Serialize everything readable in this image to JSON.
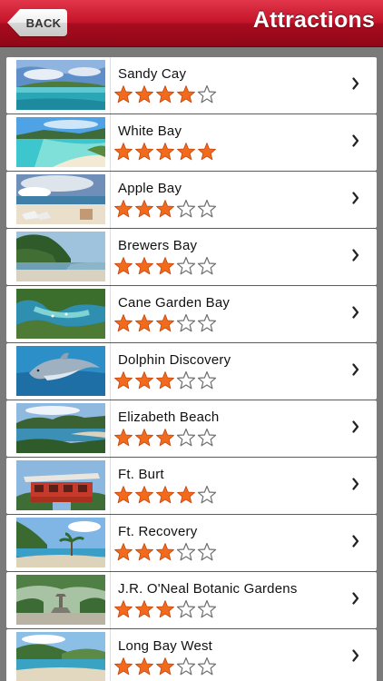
{
  "nav": {
    "back_label": "BACK",
    "title": "Attractions"
  },
  "colors": {
    "nav_red": "#c4142a",
    "star_fill": "#f26a1b",
    "list_background": "#7a7a7a"
  },
  "items": [
    {
      "name": "Sandy Cay",
      "rating": 4,
      "thumb_icon": "beach-island-photo"
    },
    {
      "name": "White Bay",
      "rating": 5,
      "thumb_icon": "turquoise-bay-photo"
    },
    {
      "name": "Apple Bay",
      "rating": 3,
      "thumb_icon": "beach-chairs-photo"
    },
    {
      "name": "Brewers Bay",
      "rating": 3,
      "thumb_icon": "green-hill-bay-photo"
    },
    {
      "name": "Cane Garden Bay",
      "rating": 3,
      "thumb_icon": "aerial-bay-photo"
    },
    {
      "name": "Dolphin Discovery",
      "rating": 3,
      "thumb_icon": "dolphin-photo"
    },
    {
      "name": "Elizabeth Beach",
      "rating": 3,
      "thumb_icon": "coastline-photo"
    },
    {
      "name": "Ft. Burt",
      "rating": 4,
      "thumb_icon": "red-building-photo"
    },
    {
      "name": "Ft. Recovery",
      "rating": 3,
      "thumb_icon": "palm-beach-photo"
    },
    {
      "name": "J.R. O'Neal Botanic Gardens",
      "rating": 3,
      "thumb_icon": "garden-fountain-photo"
    },
    {
      "name": "Long Bay West",
      "rating": 3,
      "thumb_icon": "long-beach-photo"
    }
  ]
}
